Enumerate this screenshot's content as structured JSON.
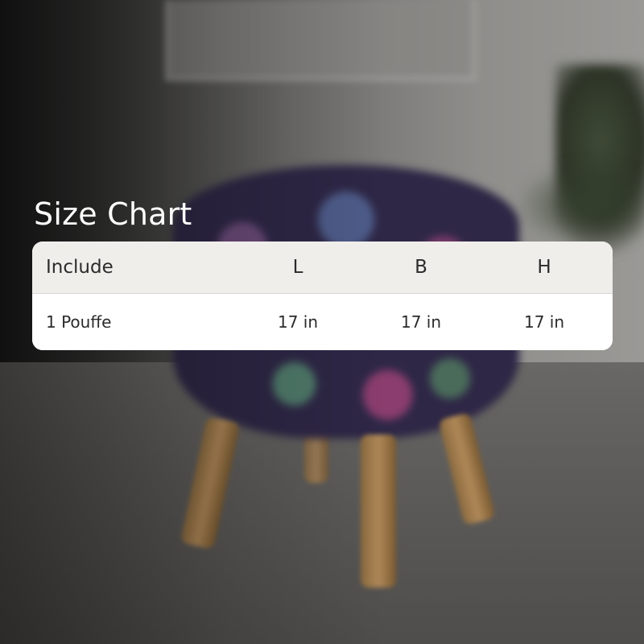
{
  "title": "Size Chart",
  "table": {
    "headers": [
      "Include",
      "L",
      "B",
      "H"
    ],
    "rows": [
      [
        "1 Pouffe",
        "17 in",
        "17 in",
        "17 in"
      ]
    ]
  },
  "colors": {
    "header_bg": "#efeeea",
    "card_bg": "#ffffff",
    "text": "#2b2b2b",
    "title": "#ffffff"
  },
  "icons": {
    "background": "pouffe-photo"
  }
}
